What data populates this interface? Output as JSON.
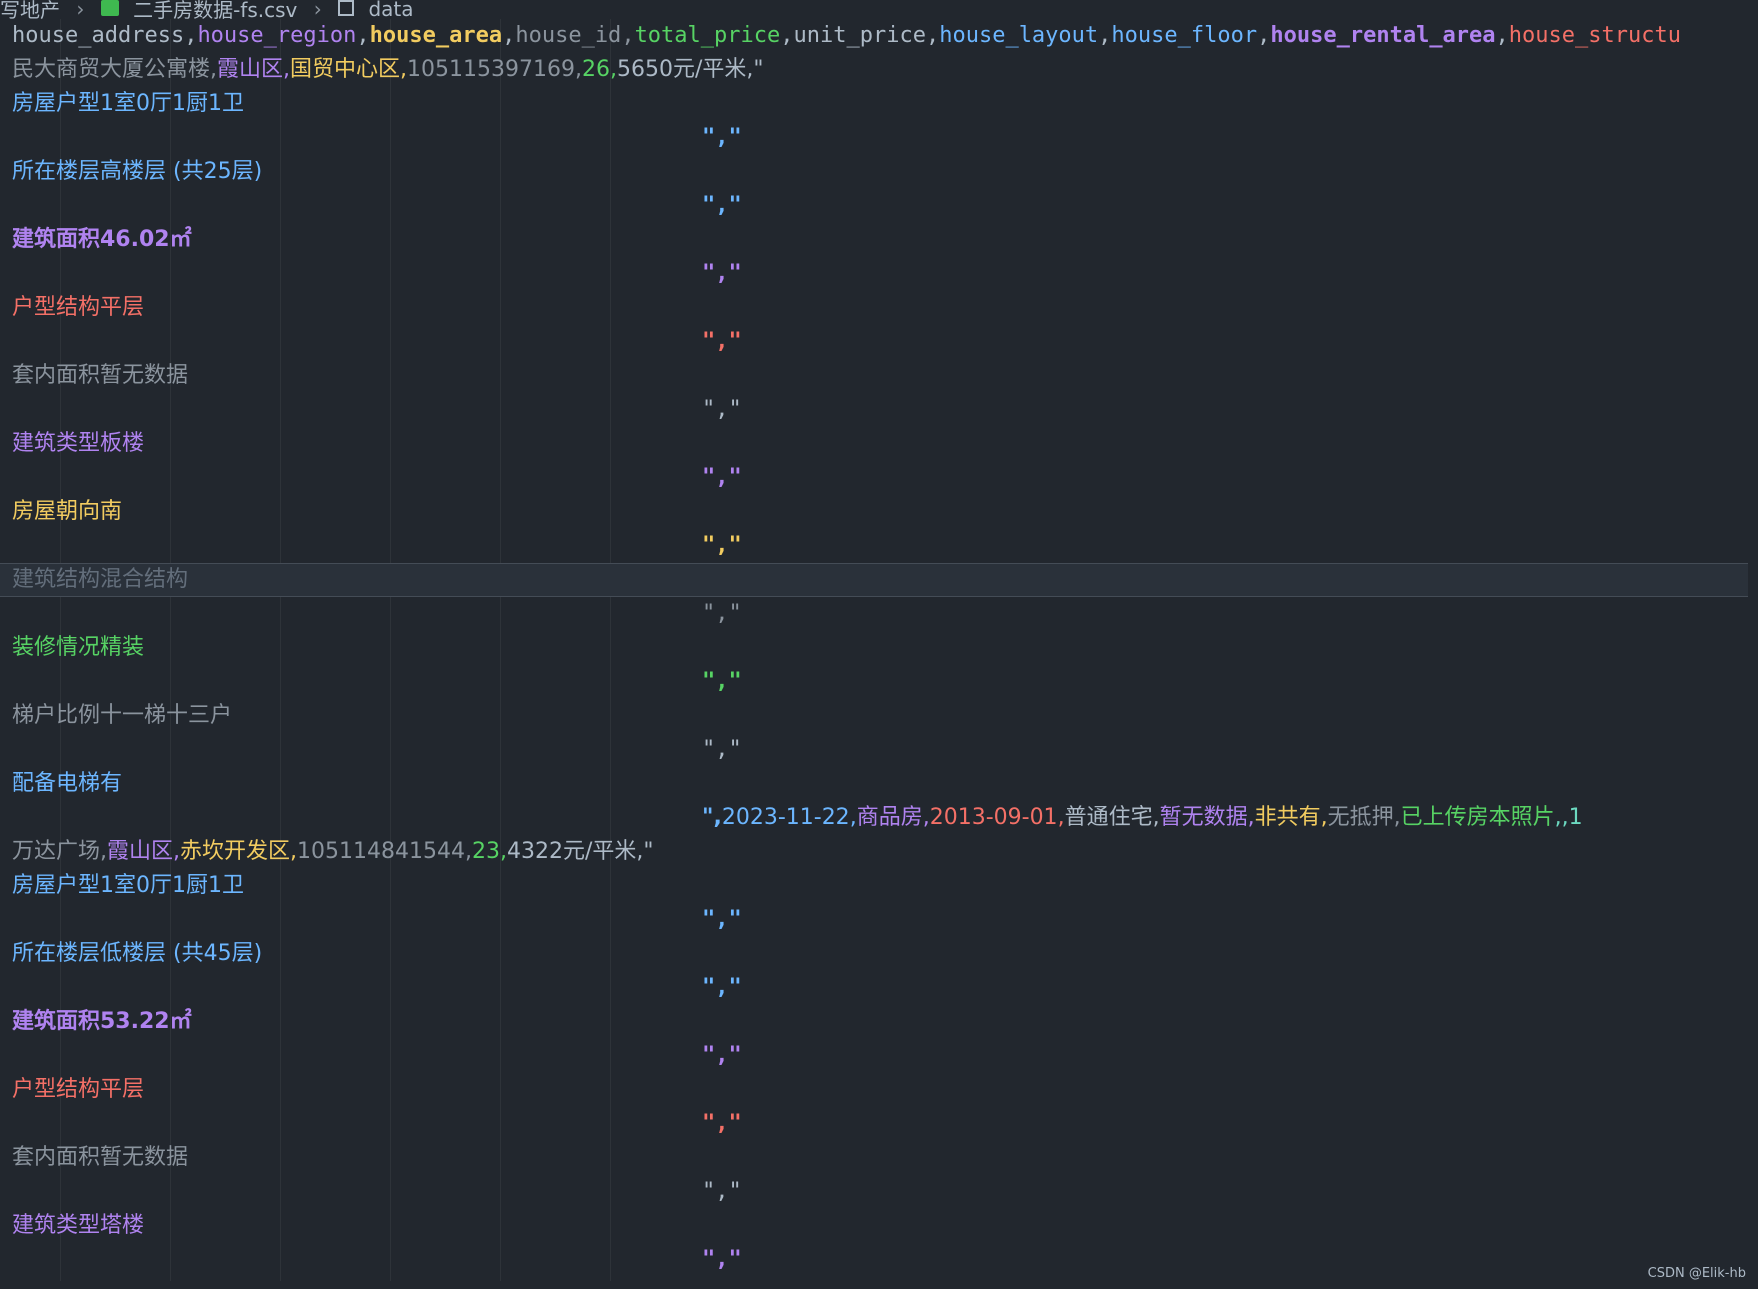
{
  "breadcrumb": {
    "root": "写地产",
    "file": "二手房数据-fs.csv",
    "node": "data"
  },
  "header": [
    "house_address",
    "house_region",
    "house_area",
    "house_id",
    "total_price",
    "unit_price",
    "house_layout",
    "house_floor",
    "house_rental_area",
    "house_structu"
  ],
  "rows": {
    "r1": [
      "民大商贸大厦公寓楼",
      ",",
      "霞山区",
      ",",
      "国贸中心区",
      ",",
      "105115397169",
      ",",
      "26",
      ",",
      "5650元/平米",
      ",\""
    ],
    "layout1": "房屋户型1室0厅1厨1卫",
    "floor1": "所在楼层高楼层 (共25层)",
    "area1": "建筑面积46.02㎡",
    "struct1": "户型结构平层",
    "inner1": "套内面积暂无数据",
    "btype1": "建筑类型板楼",
    "orient1": "房屋朝向南",
    "bstruct1": "建筑结构混合结构",
    "deco1": "装修情况精装",
    "ratio1": "梯户比例十一梯十三户",
    "elev1": "配备电梯有",
    "tail1": [
      "\",",
      "2023-11-22",
      ",",
      "商品房",
      ",",
      "2013-09-01",
      ",",
      "普通住宅",
      ",",
      "暂无数据",
      ",",
      "非共有",
      ",",
      "无抵押",
      ",",
      "已上传房本照片",
      ",,1"
    ],
    "r2": [
      "万达广场",
      ",",
      "霞山区",
      ",",
      "赤坎开发区",
      ",",
      "105114841544",
      ",",
      "23",
      ",",
      "4322元/平米",
      ",\""
    ],
    "layout2": "房屋户型1室0厅1厨1卫",
    "floor2": "所在楼层低楼层 (共45层)",
    "area2": "建筑面积53.22㎡",
    "struct2": "户型结构平层",
    "inner2": "套内面积暂无数据",
    "btype2": "建筑类型塔楼"
  },
  "sep": "\",\"",
  "watermark": "CSDN @Elik-hb"
}
